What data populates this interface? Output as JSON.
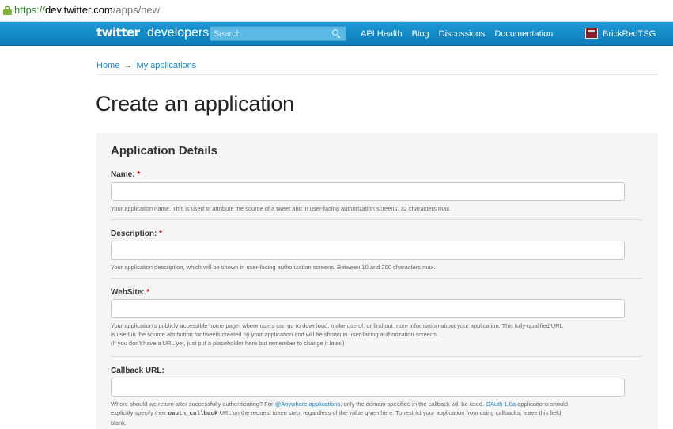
{
  "browser": {
    "url_scheme": "https://",
    "url_host": "dev.twitter.com",
    "url_path": "/apps/new"
  },
  "nav": {
    "logo": "twitter",
    "logo_suffix": "developers",
    "search_placeholder": "Search",
    "links": [
      "API Health",
      "Blog",
      "Discussions",
      "Documentation"
    ],
    "username": "BrickRedTSG"
  },
  "breadcrumb": {
    "home": "Home",
    "separator": "→",
    "current": "My applications"
  },
  "page_title": "Create an application",
  "form": {
    "section_title": "Application Details",
    "required_marker": "*",
    "fields": {
      "name": {
        "label": "Name:",
        "value": "",
        "hint": "Your application name. This is used to attribute the source of a tweet and in user-facing authorization screens. 32 characters max."
      },
      "description": {
        "label": "Description:",
        "value": "",
        "hint": "Your application description, which will be shown in user-facing authorization screens. Between 10 and 200 characters max."
      },
      "website": {
        "label": "WebSite:",
        "value": "",
        "hint_line1": "Your application's publicly accessible home page, where users can go to download, make use of, or find out more information about your application. This fully-qualified URL",
        "hint_line2": "is used in the source attribution for tweets created by your application and will be shown in user-facing authorization screens.",
        "hint_line3": "(If you don't have a URL yet, just put a placeholder here but remember to change it later.)"
      },
      "callback": {
        "label": "Callback URL:",
        "value": "",
        "hint_part1": "Where should we return after successfully authenticating? For ",
        "hint_link1": "@Anywhere applications",
        "hint_part2": ", only the domain specified in the callback will be used. ",
        "hint_link2": "OAuth 1.0a",
        "hint_part3": " applications should",
        "hint_part4": "explicitly specify their ",
        "hint_code": "oauth_callback",
        "hint_part5": " URL on the request token step, regardless of the value given here. To restrict your application from using callbacks, leave this field",
        "hint_part6": "blank."
      }
    }
  },
  "colors": {
    "nav_bg": "#1583c3",
    "link": "#1a85c5",
    "required": "#cc0000",
    "panel_bg": "#f5f5f5"
  }
}
